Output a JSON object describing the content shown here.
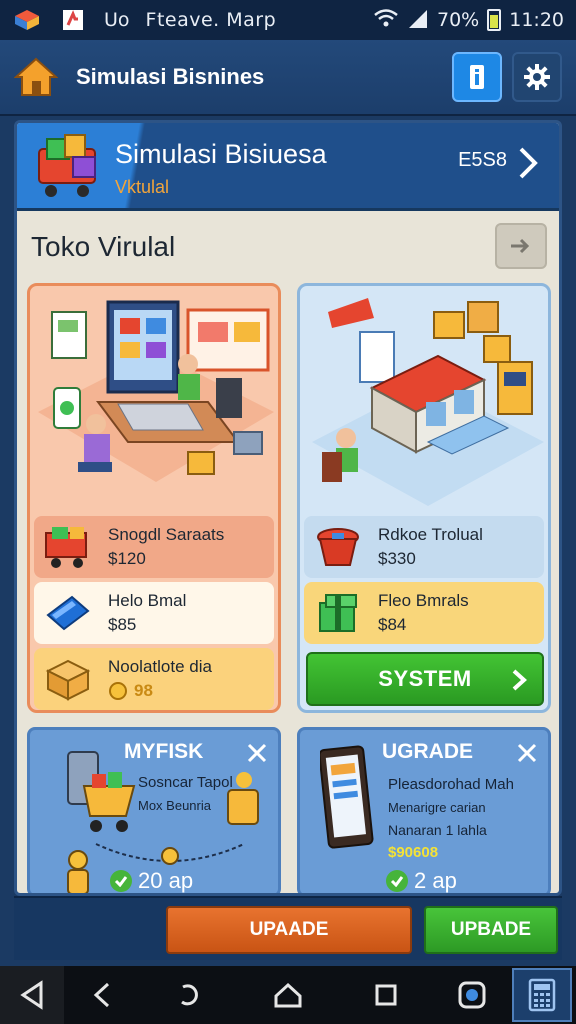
{
  "status_bar": {
    "title_short": "Uo",
    "title": "Fteave. Marp",
    "battery": "70%",
    "time": "11:20"
  },
  "app_bar": {
    "title": "Simulasi Bisnines"
  },
  "hero": {
    "title": "Simulasi Bisiuesa",
    "subtitle": "Vktulal",
    "code": "E5S8"
  },
  "section": {
    "title": "Toko Virulal"
  },
  "left_card": {
    "rows": [
      {
        "name": "Snogdl Saraats",
        "price": "$120"
      },
      {
        "name": "Helo Bmal",
        "price": "$85"
      },
      {
        "name": "Noolatlote dia",
        "price": "98"
      }
    ]
  },
  "right_card": {
    "rows": [
      {
        "name": "Rdkoe Trolual",
        "price": "$330"
      },
      {
        "name": "Fleo Bmrals",
        "price": "$84"
      }
    ],
    "system_button": "SYSTEM"
  },
  "bottom_cards": [
    {
      "title": "MYFISK",
      "line1": "Sosncar Tapol",
      "line2": "Mox Beunria",
      "footer": "20 ap"
    },
    {
      "title": "UGRADE",
      "line1": "Pleasdorohad Mah",
      "line2": "Menarigre carian",
      "line3": "Nanaran 1 lahla",
      "value": "$90608",
      "footer": "2 ap"
    }
  ],
  "action_bar": {
    "primary_label": "UPAADE",
    "secondary_label": "UPBADE"
  },
  "colors": {
    "app_bar": "#1c3e6b",
    "accent_orange": "#c95414",
    "accent_green": "#2d9a25",
    "card_peach": "#f9c8ac",
    "card_blue": "#d4e6f6"
  }
}
